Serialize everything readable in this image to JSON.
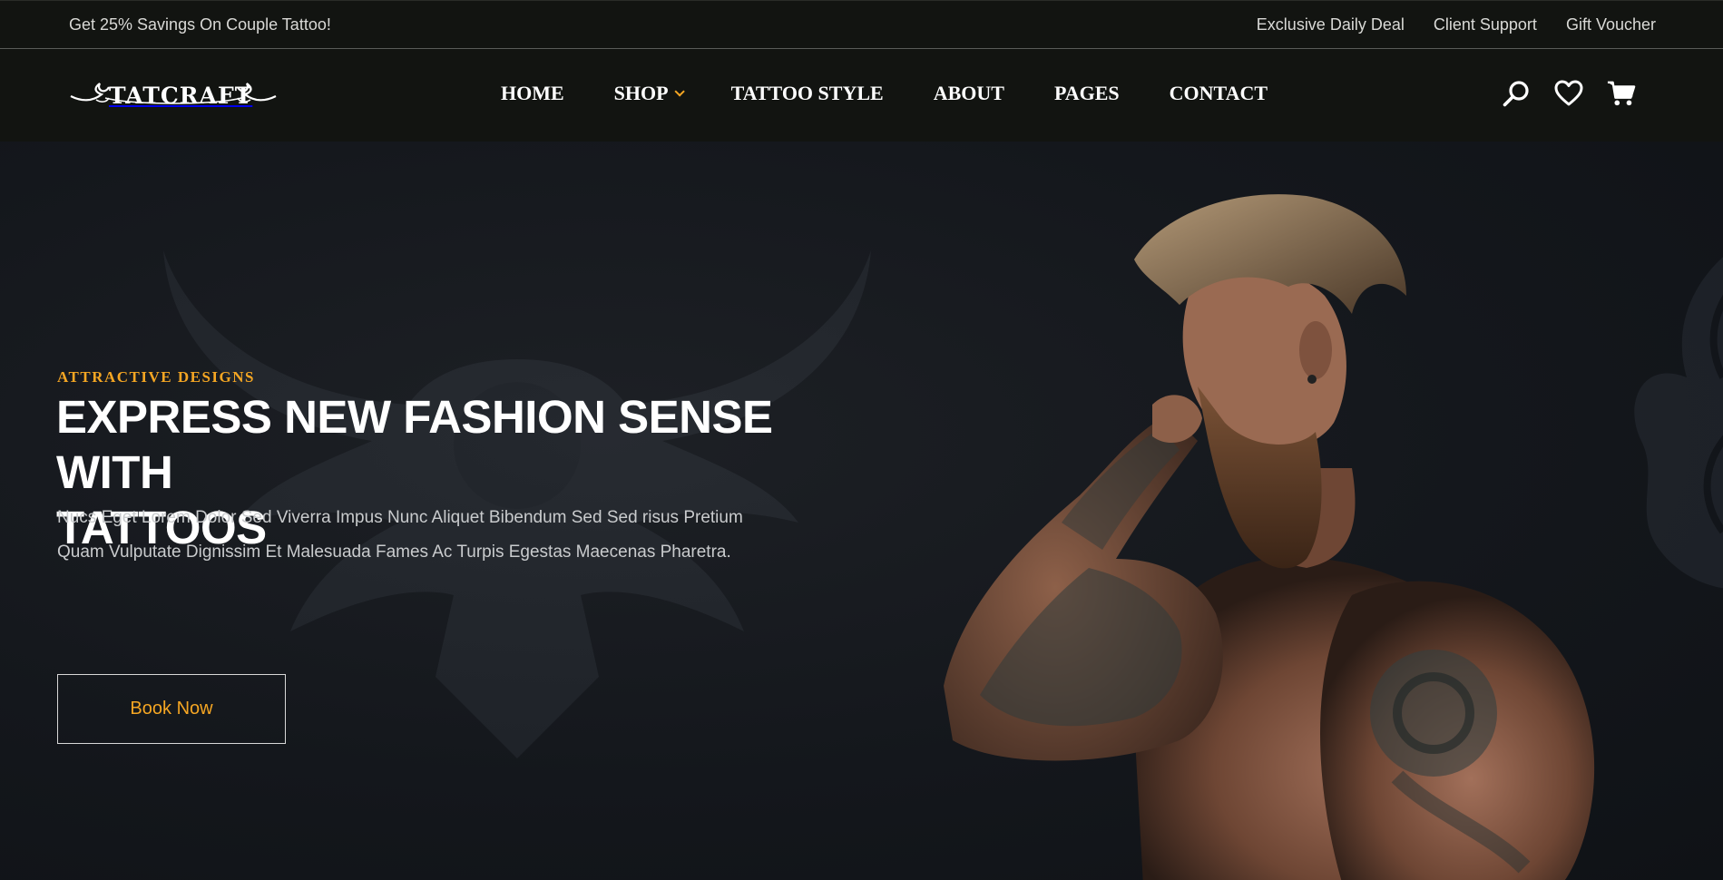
{
  "topbar": {
    "promo": "Get 25% Savings On Couple Tattoo!",
    "links": [
      "Exclusive Daily Deal",
      "Client Support",
      "Gift Voucher"
    ]
  },
  "header": {
    "logo_text": "TATCRAFT",
    "nav": [
      {
        "label": "HOME"
      },
      {
        "label": "SHOP",
        "has_dropdown": true
      },
      {
        "label": "TATTOO STYLE"
      },
      {
        "label": "ABOUT"
      },
      {
        "label": "PAGES"
      },
      {
        "label": "CONTACT"
      }
    ],
    "icons": [
      "search-icon",
      "heart-icon",
      "cart-icon"
    ]
  },
  "hero": {
    "eyebrow": "ATTRACTIVE DESIGNS",
    "headline_line1": "EXPRESS NEW FASHION SENSE WITH",
    "headline_line2": "TATTOOS",
    "desc_line1": "Nucs Eget Lorem Dolor Sed Viverra Impus Nunc Aliquet Bibendum Sed Sed risus Pretium",
    "desc_line2": "Quam Vulputate Dignissim Et Malesuada Fames Ac Turpis Egestas Maecenas Pharetra.",
    "cta_label": "Book Now"
  },
  "colors": {
    "accent": "#f5a623",
    "background": "#121411",
    "hero_bg": "#14171c"
  }
}
